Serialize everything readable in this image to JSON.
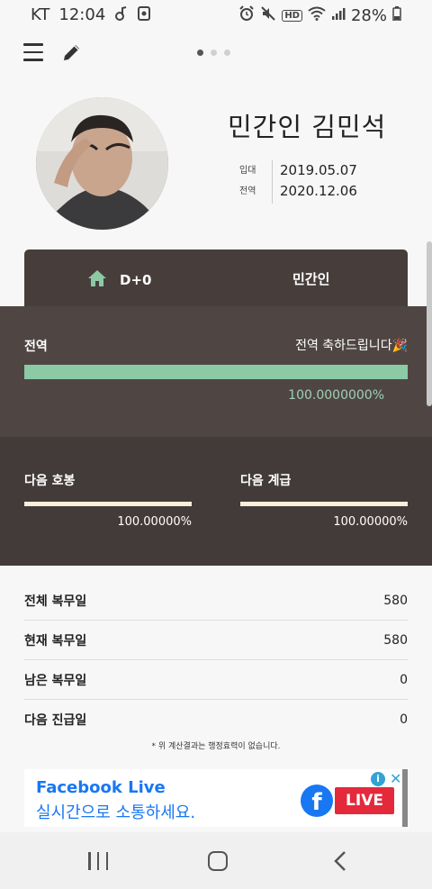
{
  "status_bar": {
    "carrier": "KT",
    "time": "12:04",
    "hd_label": "HD",
    "battery": "28%"
  },
  "top_bar": {
    "page_count": 3,
    "active_page": 0
  },
  "profile": {
    "name": "민간인 김민석",
    "enlist_label": "입대",
    "enlist_date": "2019.05.07",
    "discharge_label": "전역",
    "discharge_date": "2020.12.06"
  },
  "tab": {
    "dday": "D+0",
    "status": "민간인"
  },
  "service": {
    "label": "전역",
    "message": "전역 축하드립니다🎉",
    "progress_fraction": 1.0,
    "progress_text": "100.0000000%"
  },
  "next": {
    "pay": {
      "label": "다음 호봉",
      "fraction": 1.0,
      "text": "100.00000%"
    },
    "rank": {
      "label": "다음 계급",
      "fraction": 1.0,
      "text": "100.00000%"
    }
  },
  "stats": [
    {
      "label": "전체 복무일",
      "value": "580"
    },
    {
      "label": "현재 복무일",
      "value": "580"
    },
    {
      "label": "남은 복무일",
      "value": "0"
    },
    {
      "label": "다음 진급일",
      "value": "0"
    }
  ],
  "disclaimer": "* 위 계산결과는 행정효력이 없습니다.",
  "ad": {
    "title": "Facebook Live",
    "subtitle": "실시간으로 소통하세요.",
    "live_label": "LIVE",
    "fb_letter": "f",
    "info": "i",
    "close": "✕"
  },
  "colors": {
    "accent_green": "#8cc9a5",
    "dark_card": "#473e3c",
    "cream": "#fbefd9"
  }
}
